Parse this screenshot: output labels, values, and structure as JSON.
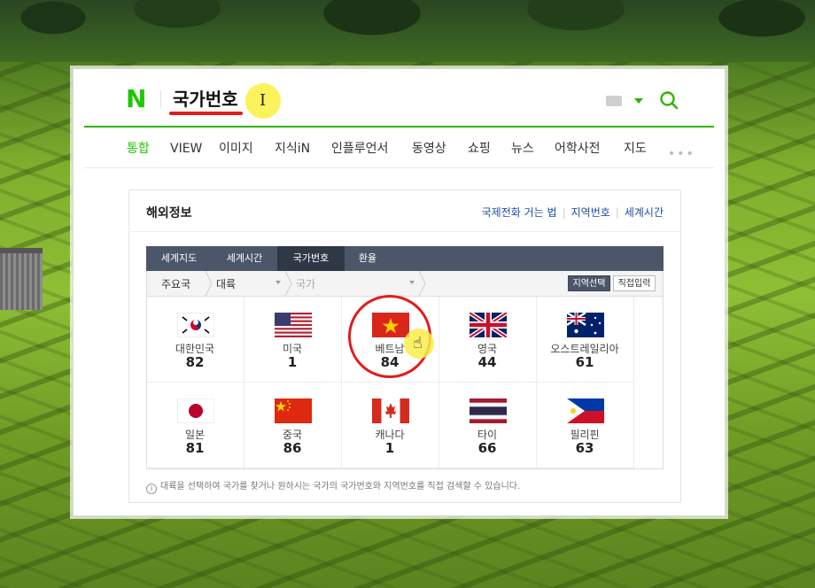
{
  "search": {
    "logo": "N",
    "query": "국가번호"
  },
  "nav": {
    "tabs": [
      "통합",
      "VIEW",
      "이미지",
      "지식iN",
      "인플루언서",
      "동영상",
      "쇼핑",
      "뉴스",
      "어학사전",
      "지도"
    ],
    "more": "•••"
  },
  "infobox": {
    "title": "해외정보",
    "links": [
      "국제전화 거는 법",
      "지역번호",
      "세계시간"
    ],
    "tabs": [
      "세계지도",
      "세계시간",
      "국가번호",
      "환율"
    ],
    "breadcrumb": {
      "root": "주요국",
      "continent": "대륙",
      "country": "국가"
    },
    "buttons": {
      "select_region": "지역선택",
      "direct_input": "직접입력"
    },
    "countries": [
      {
        "name": "대한민국",
        "code": "82",
        "flag": "korea-flag-icon"
      },
      {
        "name": "미국",
        "code": "1",
        "flag": "usa-flag-icon"
      },
      {
        "name": "베트남",
        "code": "84",
        "flag": "vietnam-flag-icon"
      },
      {
        "name": "영국",
        "code": "44",
        "flag": "uk-flag-icon"
      },
      {
        "name": "오스트레일리아",
        "code": "61",
        "flag": "australia-flag-icon"
      },
      {
        "name": "일본",
        "code": "81",
        "flag": "japan-flag-icon"
      },
      {
        "name": "중국",
        "code": "86",
        "flag": "china-flag-icon"
      },
      {
        "name": "캐나다",
        "code": "1",
        "flag": "canada-flag-icon"
      },
      {
        "name": "타이",
        "code": "66",
        "flag": "thailand-flag-icon"
      },
      {
        "name": "필리핀",
        "code": "63",
        "flag": "philippines-flag-icon"
      }
    ],
    "note_icon": "i",
    "note": "대륙을 선택하여 국가를 찾거나 원하시는 국가의 국가번호와 지역번호를 직접 검색할 수 있습니다."
  },
  "colors": {
    "brand_green": "#1ec800",
    "tab_bar": "#4b5668",
    "highlight_red": "#e21c1c",
    "cursor_yellow": "#fbf14a",
    "link_blue": "#1f4fa0"
  }
}
